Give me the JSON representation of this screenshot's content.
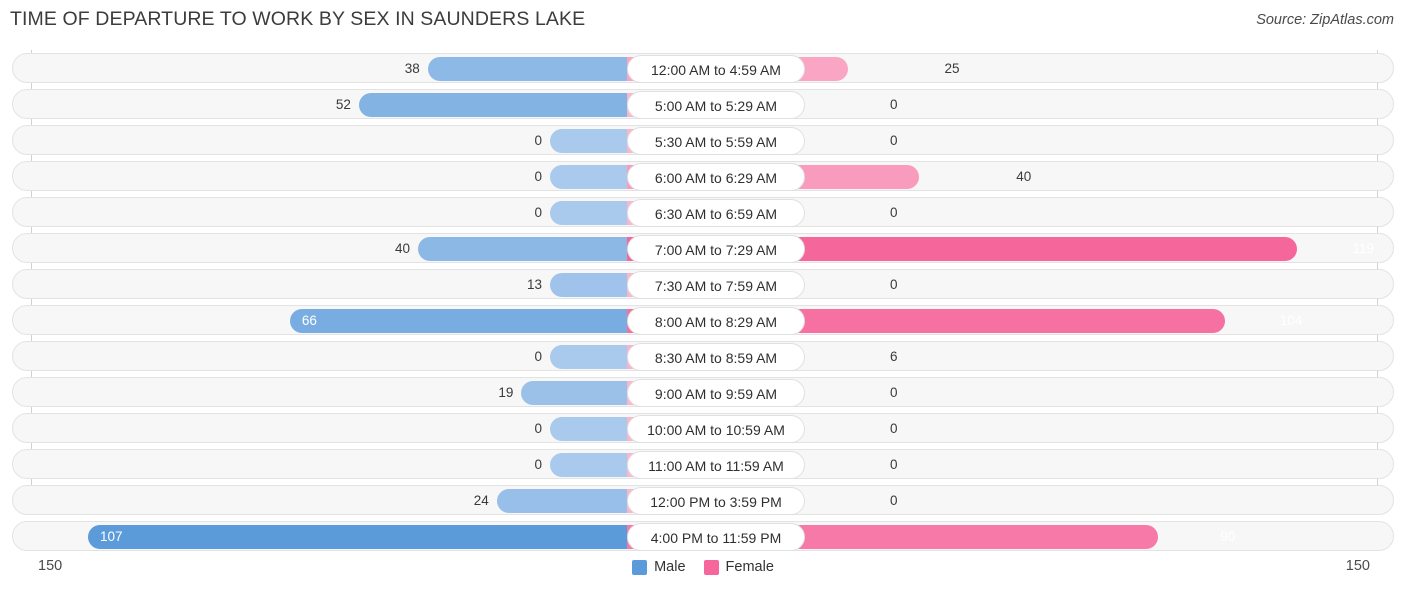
{
  "title": "TIME OF DEPARTURE TO WORK BY SEX IN SAUNDERS LAKE",
  "source": "Source: ZipAtlas.com",
  "axis": {
    "left_tick": "150",
    "right_tick": "150"
  },
  "legend": {
    "items": [
      {
        "label": "Male",
        "color": "#5b9bd9"
      },
      {
        "label": "Female",
        "color": "#f5669a"
      }
    ]
  },
  "colors": {
    "male_max": "#5b9bd9",
    "male_min": "#a9c9ed",
    "female_max": "#f5669a",
    "female_min": "#fbb6ce",
    "row_background": "#f7f7f7",
    "row_border": "#e3e3e3",
    "axis_line": "#d2d2d2"
  },
  "chart_data": {
    "type": "bar",
    "subtype": "diverging-bar",
    "title": "TIME OF DEPARTURE TO WORK BY SEX IN SAUNDERS LAKE",
    "xlabel": "",
    "ylabel": "",
    "xlim": [
      0,
      150
    ],
    "grid": false,
    "legend_position": "bottom-center",
    "categories": [
      "12:00 AM to 4:59 AM",
      "5:00 AM to 5:29 AM",
      "5:30 AM to 5:59 AM",
      "6:00 AM to 6:29 AM",
      "6:30 AM to 6:59 AM",
      "7:00 AM to 7:29 AM",
      "7:30 AM to 7:59 AM",
      "8:00 AM to 8:29 AM",
      "8:30 AM to 8:59 AM",
      "9:00 AM to 9:59 AM",
      "10:00 AM to 10:59 AM",
      "11:00 AM to 11:59 AM",
      "12:00 PM to 3:59 PM",
      "4:00 PM to 11:59 PM"
    ],
    "series": [
      {
        "name": "Male",
        "direction": "left",
        "values": [
          38,
          52,
          0,
          0,
          0,
          40,
          13,
          66,
          0,
          19,
          0,
          0,
          24,
          107
        ]
      },
      {
        "name": "Female",
        "direction": "right",
        "values": [
          25,
          0,
          0,
          40,
          0,
          119,
          0,
          104,
          6,
          0,
          0,
          0,
          0,
          90
        ]
      }
    ]
  }
}
